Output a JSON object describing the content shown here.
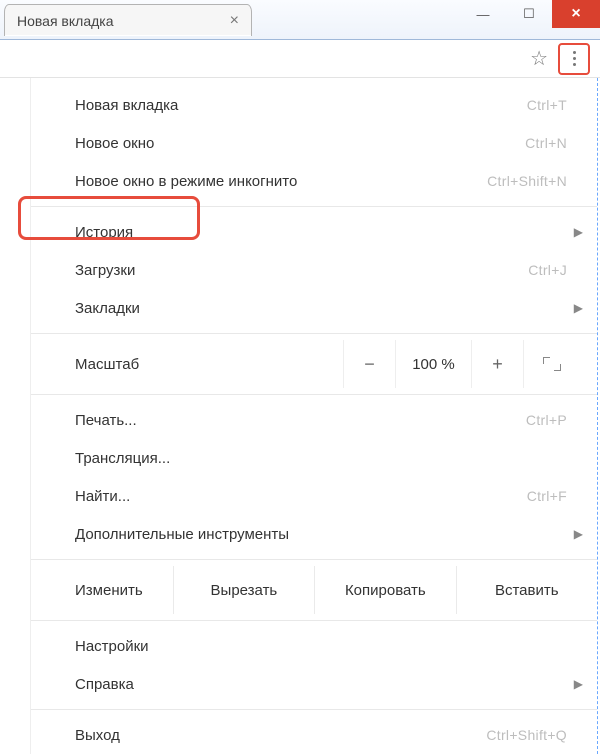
{
  "tab": {
    "title": "Новая вкладка"
  },
  "menu": {
    "new_tab": {
      "label": "Новая вкладка",
      "shortcut": "Ctrl+T"
    },
    "new_win": {
      "label": "Новое окно",
      "shortcut": "Ctrl+N"
    },
    "incognito": {
      "label": "Новое окно в режиме инкогнито",
      "shortcut": "Ctrl+Shift+N"
    },
    "history": {
      "label": "История"
    },
    "downloads": {
      "label": "Загрузки",
      "shortcut": "Ctrl+J"
    },
    "bookmarks": {
      "label": "Закладки"
    },
    "zoom": {
      "label": "Масштаб",
      "value": "100 %"
    },
    "print": {
      "label": "Печать...",
      "shortcut": "Ctrl+P"
    },
    "cast": {
      "label": "Трансляция..."
    },
    "find": {
      "label": "Найти...",
      "shortcut": "Ctrl+F"
    },
    "moretools": {
      "label": "Дополнительные инструменты"
    },
    "edit": {
      "label": "Изменить",
      "cut": "Вырезать",
      "copy": "Копировать",
      "paste": "Вставить"
    },
    "settings": {
      "label": "Настройки"
    },
    "help": {
      "label": "Справка"
    },
    "exit": {
      "label": "Выход",
      "shortcut": "Ctrl+Shift+Q"
    }
  }
}
